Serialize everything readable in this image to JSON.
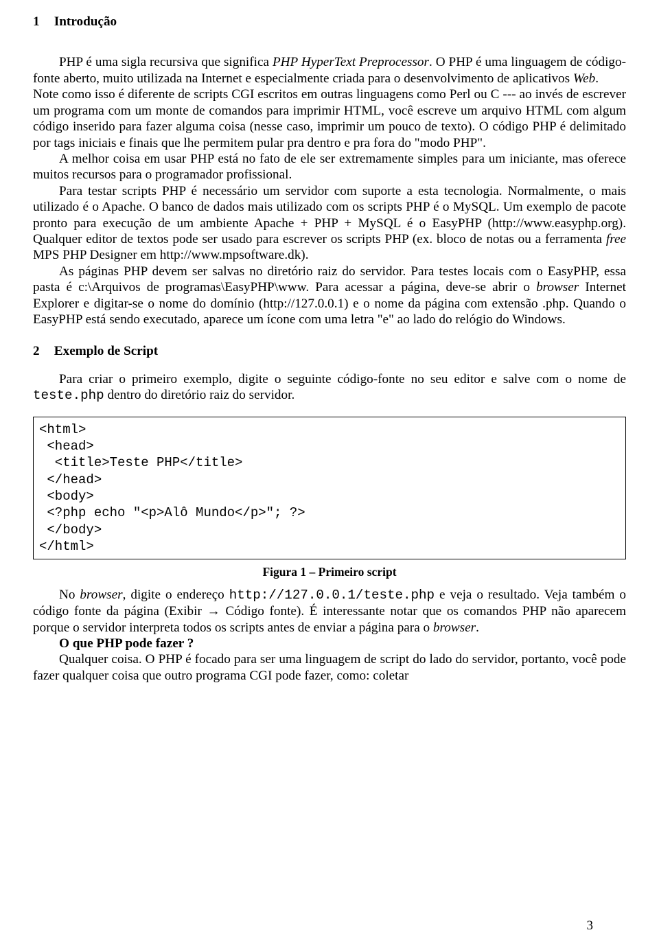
{
  "section1": {
    "number": "1",
    "title": "Introdução",
    "p1a": "PHP é uma sigla recursiva que significa ",
    "p1b": "PHP HyperText Preprocessor",
    "p1c": ". O PHP é uma linguagem de código-fonte aberto, muito utilizada na Internet e especialmente criada para o desenvolvimento de aplicativos ",
    "p1d": "Web",
    "p1e": ".",
    "p2": "Note como isso é diferente de scripts CGI escritos em outras linguagens como Perl ou C --- ao invés de escrever um programa com um monte de comandos para imprimir HTML, você escreve um arquivo HTML com algum código inserido para fazer alguma coisa (nesse caso, imprimir um pouco de texto). O código PHP é delimitado por tags iniciais e finais que lhe permitem pular pra dentro e pra fora do \"modo PHP\".",
    "p3": "A melhor coisa em usar PHP está no fato de ele ser extremamente simples para um iniciante, mas oferece muitos recursos para o programador profissional.",
    "p4a": "Para testar scripts PHP é necessário um servidor com suporte a esta tecnologia. Normalmente, o mais utilizado é o Apache. O banco de dados mais utilizado com os scripts PHP é o MySQL. Um exemplo de pacote pronto para execução de um ambiente Apache + PHP + MySQL é o EasyPHP (http://www.easyphp.org). Qualquer editor de textos pode ser usado para escrever os scripts PHP (ex. bloco de notas ou a ferramenta ",
    "p4b": "free",
    "p4c": " MPS PHP Designer em http://www.mpsoftware.dk).",
    "p5a": "As páginas PHP devem ser salvas no diretório raiz do servidor. Para testes locais com o EasyPHP, essa pasta é c:\\Arquivos de programas\\EasyPHP\\www. Para acessar a página, deve-se abrir o ",
    "p5b": "browser",
    "p5c": " Internet Explorer e digitar-se o nome do domínio (http://127.0.0.1) e o nome da página com extensão .php. Quando o EasyPHP está sendo executado, aparece um ícone com uma letra \"e\" ao lado do relógio do Windows."
  },
  "section2": {
    "number": "2",
    "title": "Exemplo de Script",
    "p1a": "Para criar o primeiro exemplo, digite o seguinte código-fonte no seu editor e salve com o nome de ",
    "p1b": "teste.php",
    "p1c": " dentro do diretório raiz do servidor."
  },
  "code": {
    "l1": "<html>",
    "l2": " <head>",
    "l3": "  <title>Teste PHP</title>",
    "l4": " </head>",
    "l5": " <body>",
    "l6": " <?php echo \"<p>Alô Mundo</p>\"; ?>",
    "l7": " </body>",
    "l8": "</html>"
  },
  "figcaption": "Figura 1 – Primeiro script",
  "after": {
    "p1a": "No ",
    "p1b": "browser",
    "p1c": ", digite o endereço ",
    "p1d": "http://127.0.0.1/teste.php",
    "p1e": " e veja o resultado. Veja também o código fonte da página (Exibir → Código fonte). É interessante notar que os comandos PHP não aparecem porque o servidor interpreta todos os scripts antes de enviar a página para o ",
    "p1f": "browser",
    "p1g": ".",
    "p2": "O que PHP pode fazer ?",
    "p3": "Qualquer coisa. O PHP é focado para ser uma linguagem de script do lado do servidor, portanto, você pode fazer qualquer coisa que outro programa CGI pode fazer, como: coletar"
  },
  "pagenum": "3"
}
